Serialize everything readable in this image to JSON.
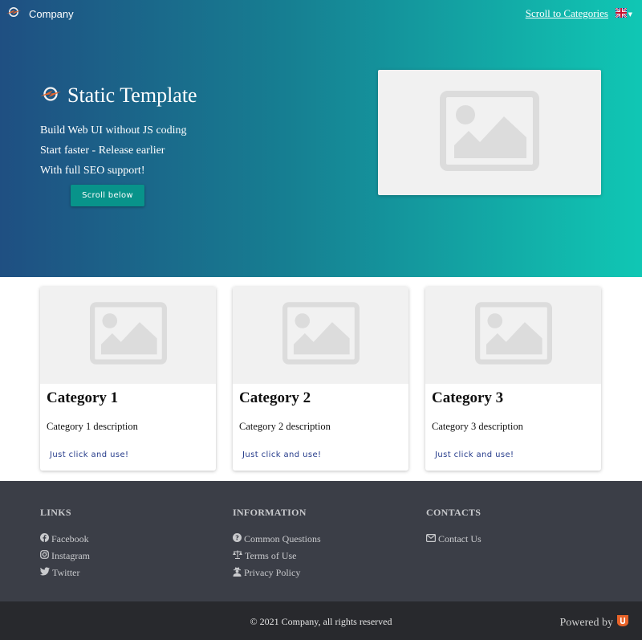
{
  "header": {
    "brand": "Company",
    "scroll_link": "Scroll to Categories",
    "language_icon": "uk-flag-icon"
  },
  "hero": {
    "title": "Static Template",
    "lines": [
      "Build Web UI without JS coding",
      "Start faster - Release earlier",
      "With full SEO support!"
    ],
    "button": "Scroll below",
    "image_icon": "image-placeholder-icon",
    "colors": {
      "gradient_start": "#1f4f82",
      "gradient_end": "#10c7b4",
      "button": "#08938a"
    }
  },
  "categories": [
    {
      "title": "Category 1",
      "description": "Category 1 description",
      "link": "Just click and use!"
    },
    {
      "title": "Category 2",
      "description": "Category 2 description",
      "link": "Just click and use!"
    },
    {
      "title": "Category 3",
      "description": "Category 3 description",
      "link": "Just click and use!"
    }
  ],
  "footer": {
    "columns": [
      {
        "heading": "LINKS",
        "items": [
          {
            "label": "Facebook",
            "icon": "facebook-icon"
          },
          {
            "label": "Instagram",
            "icon": "instagram-icon"
          },
          {
            "label": "Twitter",
            "icon": "twitter-icon"
          }
        ]
      },
      {
        "heading": "INFORMATION",
        "items": [
          {
            "label": "Common Questions",
            "icon": "question-circle-icon"
          },
          {
            "label": "Terms of Use",
            "icon": "balance-scale-icon"
          },
          {
            "label": "Privacy Policy",
            "icon": "user-secret-icon"
          }
        ]
      },
      {
        "heading": "CONTACTS",
        "items": [
          {
            "label": "Contact Us",
            "icon": "envelope-icon"
          }
        ]
      }
    ],
    "copyright": "© 2021 Company, all rights reserved",
    "powered_by": "Powered by",
    "powered_icon": "u-logo-icon",
    "colors": {
      "footer": "#3b3e47",
      "bottom": "#28292d",
      "accent": "#e8642a"
    }
  }
}
